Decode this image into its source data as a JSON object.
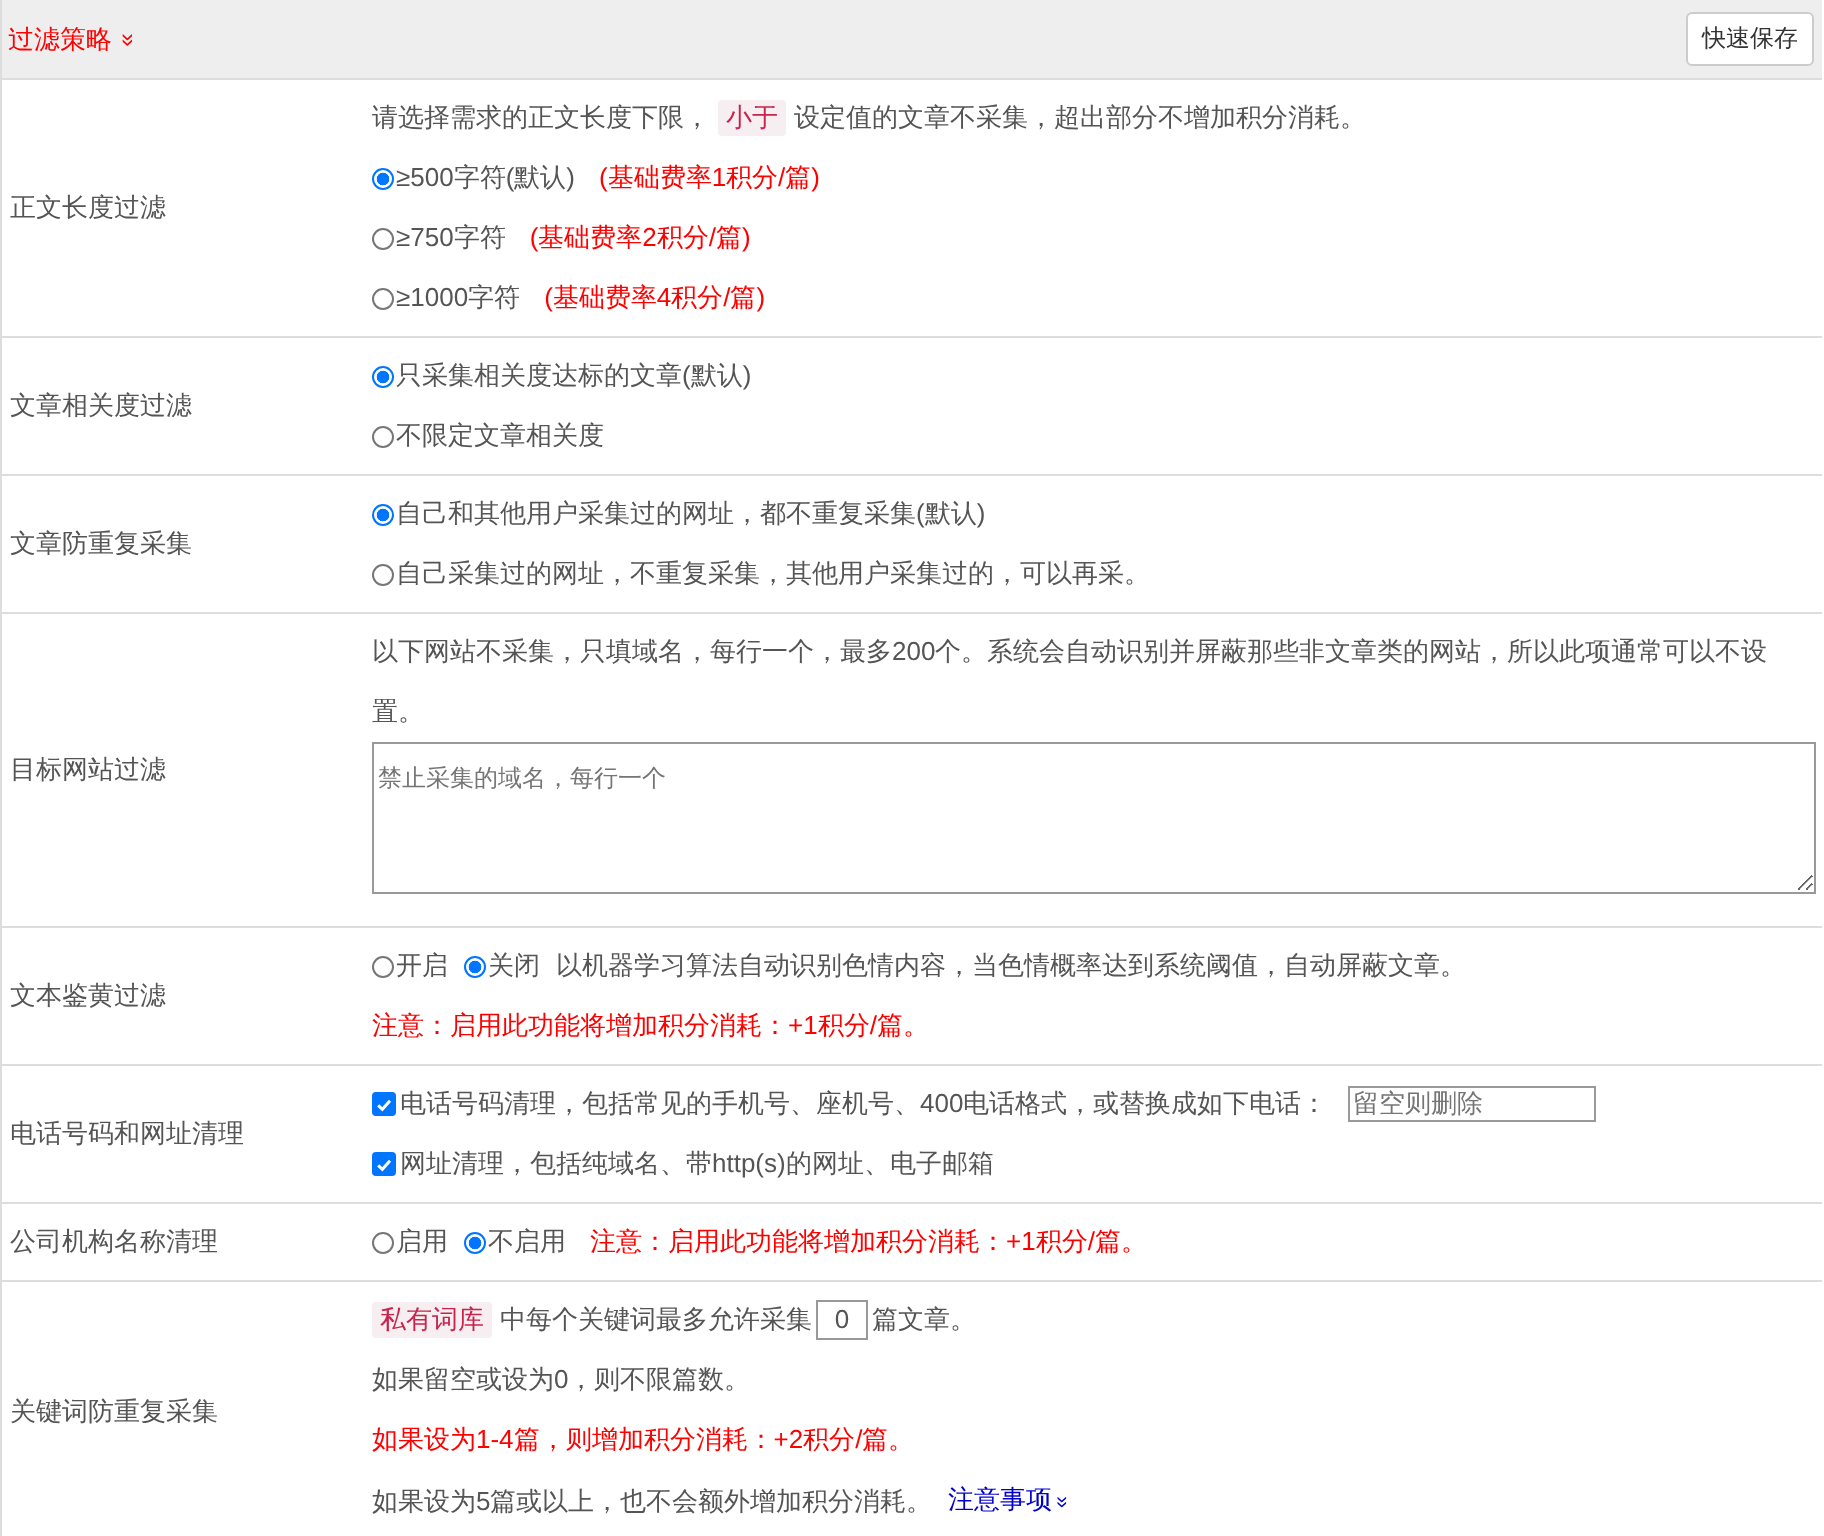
{
  "header": {
    "title": "过滤策略",
    "toggle": "»",
    "save_button": "快速保存"
  },
  "rows": [
    {
      "label": "正文长度过滤",
      "lines": [
        [
          {
            "kind": "text",
            "text": "请选择需求的正文长度下限，"
          },
          {
            "kind": "tag",
            "text": "小于"
          },
          {
            "kind": "text",
            "text": "设定值的文章不采集，超出部分不增加积分消耗。"
          }
        ],
        [
          {
            "kind": "radio",
            "label": "≥500字符(默认)",
            "selected": true
          },
          {
            "kind": "warn",
            "text": "(基础费率1积分/篇)"
          }
        ],
        [
          {
            "kind": "radio",
            "label": "≥750字符",
            "selected": false
          },
          {
            "kind": "warn",
            "text": "(基础费率2积分/篇)"
          }
        ],
        [
          {
            "kind": "radio",
            "label": "≥1000字符",
            "selected": false
          },
          {
            "kind": "warn",
            "text": "(基础费率4积分/篇)"
          }
        ]
      ]
    },
    {
      "label": "文章相关度过滤",
      "lines": [
        [
          {
            "kind": "radio",
            "label": "只采集相关度达标的文章(默认)",
            "selected": true
          }
        ],
        [
          {
            "kind": "radio",
            "label": "不限定文章相关度",
            "selected": false
          }
        ]
      ]
    },
    {
      "label": "文章防重复采集",
      "lines": [
        [
          {
            "kind": "radio",
            "label": "自己和其他用户采集过的网址，都不重复采集(默认)",
            "selected": true
          }
        ],
        [
          {
            "kind": "radio",
            "label": "自己采集过的网址，不重复采集，其他用户采集过的，可以再采。",
            "selected": false
          }
        ]
      ]
    },
    {
      "label": "目标网站过滤",
      "lines": [
        [
          {
            "kind": "text",
            "text": "以下网站不采集，只填域名，每行一个，最多200个。系统会自动识别并屏蔽那些非文章类的网站，所以此项通常可以不设置。"
          }
        ],
        [
          {
            "kind": "textarea",
            "placeholder": "禁止采集的域名，每行一个"
          }
        ]
      ]
    },
    {
      "label": "文本鉴黄过滤",
      "lines": [
        [
          {
            "kind": "radio",
            "label": "开启",
            "selected": false
          },
          {
            "kind": "radio",
            "label": "关闭",
            "selected": true
          },
          {
            "kind": "text",
            "text": "以机器学习算法自动识别色情内容，当色情概率达到系统阈值，自动屏蔽文章。"
          }
        ],
        [
          {
            "kind": "warn",
            "text": "注意：启用此功能将增加积分消耗：+1积分/篇。"
          }
        ]
      ]
    },
    {
      "label": "电话号码和网址清理",
      "lines": [
        [
          {
            "kind": "check",
            "label": "电话号码清理，包括常见的手机号、座机号、400电话格式，或替换成如下电话：",
            "checked": true
          },
          {
            "kind": "input",
            "placeholder": "留空则删除"
          }
        ],
        [
          {
            "kind": "check",
            "label": "网址清理，包括纯域名、带http(s)的网址、电子邮箱",
            "checked": true
          }
        ]
      ]
    },
    {
      "label": "公司机构名称清理",
      "lines": [
        [
          {
            "kind": "radio",
            "label": "启用",
            "selected": false
          },
          {
            "kind": "radio",
            "label": "不启用",
            "selected": true
          },
          {
            "kind": "warn",
            "text": "注意：启用此功能将增加积分消耗：+1积分/篇。"
          }
        ]
      ]
    },
    {
      "label": "关键词防重复采集",
      "lines": [
        [
          {
            "kind": "tag",
            "text": "私有词库"
          },
          {
            "kind": "text",
            "text": "中每个关键词最多允许采集"
          },
          {
            "kind": "number",
            "value": "0"
          },
          {
            "kind": "text",
            "text": "篇文章。"
          }
        ],
        [
          {
            "kind": "text",
            "text": "如果留空或设为0，则不限篇数。"
          }
        ],
        [
          {
            "kind": "warn",
            "text": "如果设为1-4篇，则增加积分消耗：+2积分/篇。"
          }
        ],
        [
          {
            "kind": "text",
            "text": "如果设为5篇或以上，也不会额外增加积分消耗。"
          },
          {
            "kind": "link",
            "text": "注意事项",
            "toggle": "»"
          }
        ]
      ]
    }
  ]
}
